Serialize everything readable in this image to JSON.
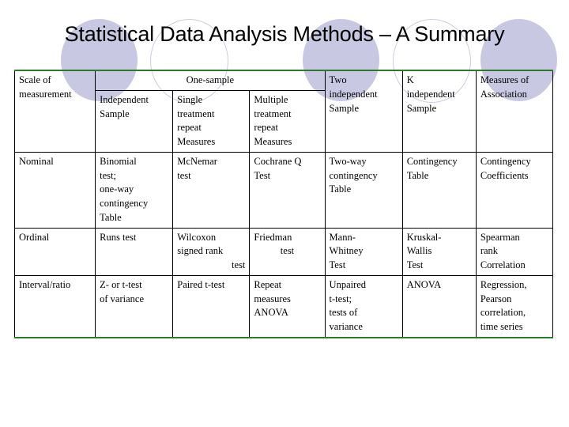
{
  "title": "Statistical Data Analysis Methods – A Summary",
  "decor": {
    "fill_color": "#c8c8e2",
    "outline_color": "#ccccdf"
  },
  "table": {
    "border_accent_color": "#2d7a2d",
    "border_color": "#000000",
    "header": {
      "scale_of_measurement": "Scale of\nmeasurement",
      "scale_line1": "Scale of",
      "scale_line2": "measurement",
      "one_sample_group": "One-sample",
      "sub_independent_sample": "Independent\nSample",
      "sub_independent_l1": "Independent",
      "sub_independent_l2": "Sample",
      "sub_single_l1": "Single",
      "sub_single_l2": "treatment",
      "sub_single_l3": "repeat",
      "sub_single_l4": "Measures",
      "sub_multiple_l1": "Multiple",
      "sub_multiple_l2": "treatment",
      "sub_multiple_l3": "repeat",
      "sub_multiple_l4": "Measures",
      "two_independent_l1": "Two",
      "two_independent_l2": "independent",
      "two_independent_l3": "Sample",
      "k_independent_l1": "K",
      "k_independent_l2": "independent",
      "k_independent_l3": "Sample",
      "measures_assoc_l1": "Measures of",
      "measures_assoc_l2": "Association"
    },
    "rows": [
      {
        "scale": "Nominal",
        "independent_sample_l1": "Binomial",
        "independent_sample_l2": "test;",
        "independent_sample_l3": "one-way",
        "independent_sample_l4": "contingency",
        "independent_sample_l5": "Table",
        "single_repeat_l1": "McNemar",
        "single_repeat_l2": "test",
        "multiple_repeat_l1": "Cochrane Q",
        "multiple_repeat_l2": "Test",
        "two_independent_l1": "Two-way",
        "two_independent_l2": "contingency",
        "two_independent_l3": "Table",
        "k_independent_l1": "Contingency",
        "k_independent_l2": "Table",
        "measures_assoc_l1": "Contingency",
        "measures_assoc_l2": "Coefficients"
      },
      {
        "scale": "Ordinal",
        "independent_sample_l1": "Runs test",
        "single_repeat_l1": "Wilcoxon",
        "single_repeat_l2": "signed rank",
        "single_repeat_l3": "test",
        "multiple_repeat_l1": "Friedman",
        "multiple_repeat_l2": "test",
        "two_independent_l1": "Mann-",
        "two_independent_l2": "Whitney",
        "two_independent_l3": "Test",
        "k_independent_l1": "Kruskal-",
        "k_independent_l2": "Wallis",
        "k_independent_l3": "Test",
        "measures_assoc_l1": "Spearman",
        "measures_assoc_l2": "rank",
        "measures_assoc_l3": "Correlation"
      },
      {
        "scale": "Interval/ratio",
        "independent_sample_l1": "Z- or t-test",
        "independent_sample_l2": "of variance",
        "single_repeat_l1": "Paired t-test",
        "multiple_repeat_l1": "Repeat",
        "multiple_repeat_l2": "measures",
        "multiple_repeat_l3": "ANOVA",
        "two_independent_l1": "Unpaired",
        "two_independent_l2": "t-test;",
        "two_independent_l3": "tests of",
        "two_independent_l4": "variance",
        "k_independent_l1": "ANOVA",
        "measures_assoc_l1": "Regression,",
        "measures_assoc_l2": "Pearson",
        "measures_assoc_l3": "correlation,",
        "measures_assoc_l4": "time series"
      }
    ]
  }
}
